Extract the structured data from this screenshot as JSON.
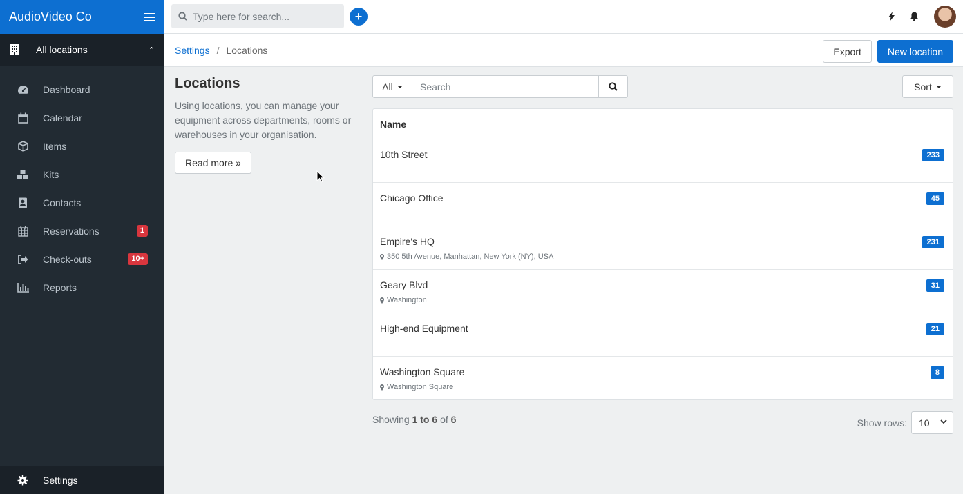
{
  "app": {
    "brand": "AudioVideo Co"
  },
  "location_switcher": {
    "label": "All locations"
  },
  "sidebar": {
    "items": [
      {
        "label": "Dashboard",
        "icon": "dashboard-icon"
      },
      {
        "label": "Calendar",
        "icon": "calendar-icon"
      },
      {
        "label": "Items",
        "icon": "cube-icon"
      },
      {
        "label": "Kits",
        "icon": "cubes-icon"
      },
      {
        "label": "Contacts",
        "icon": "address-book-icon"
      },
      {
        "label": "Reservations",
        "icon": "calendar-grid-icon",
        "badge": "1"
      },
      {
        "label": "Check-outs",
        "icon": "sign-out-icon",
        "badge": "10+"
      },
      {
        "label": "Reports",
        "icon": "bar-chart-icon"
      }
    ],
    "settings_label": "Settings"
  },
  "topbar": {
    "search_placeholder": "Type here for search..."
  },
  "breadcrumb": {
    "parent": "Settings",
    "separator": "/",
    "current": "Locations"
  },
  "actions": {
    "export_label": "Export",
    "new_label": "New location"
  },
  "info": {
    "title": "Locations",
    "description": "Using locations, you can manage your equipment across departments, rooms or warehouses in your organisation.",
    "read_more": "Read more »"
  },
  "filter": {
    "all_label": "All",
    "search_placeholder": "Search",
    "sort_label": "Sort"
  },
  "table": {
    "header": "Name",
    "rows": [
      {
        "name": "10th Street",
        "address": "",
        "count": "233"
      },
      {
        "name": "Chicago Office",
        "address": "",
        "count": "45"
      },
      {
        "name": "Empire's HQ",
        "address": "350 5th Avenue, Manhattan, New York (NY), USA",
        "count": "231"
      },
      {
        "name": "Geary Blvd",
        "address": "Washington",
        "count": "31"
      },
      {
        "name": "High-end Equipment",
        "address": "",
        "count": "21"
      },
      {
        "name": "Washington Square",
        "address": "Washington Square",
        "count": "8"
      }
    ]
  },
  "footer": {
    "showing_prefix": "Showing",
    "range": "1 to 6",
    "of": "of",
    "total": "6",
    "rows_label": "Show rows:",
    "rows_value": "10"
  },
  "colors": {
    "primary": "#0d6fd1",
    "sidebar": "#222b33",
    "badge_red": "#d9363e"
  }
}
